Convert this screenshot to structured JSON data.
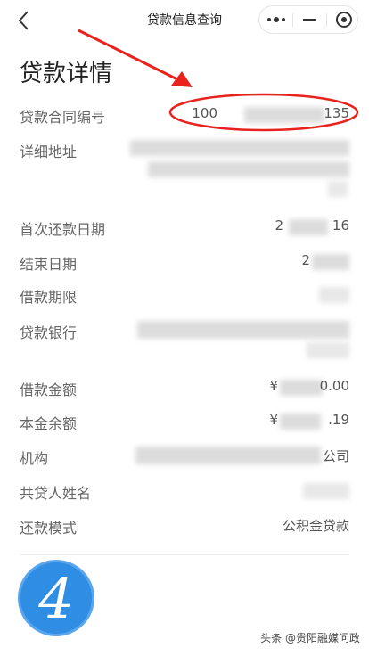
{
  "nav": {
    "title": "贷款信息查询",
    "back_icon": "chevron-left-icon",
    "more_icon": "more-dots-icon",
    "minimize_icon": "minus-icon",
    "close_icon": "target-circle-icon"
  },
  "page_title": "贷款详情",
  "fields": {
    "contract_no": {
      "label": "贷款合同编号",
      "value_prefix": "100",
      "value_suffix": "135"
    },
    "address": {
      "label": "详细地址"
    },
    "first_repay_date": {
      "label": "首次还款日期",
      "value_prefix": "2",
      "value_suffix": "16"
    },
    "end_date": {
      "label": "结束日期",
      "value_prefix": "2"
    },
    "loan_term": {
      "label": "借款期限"
    },
    "lending_bank": {
      "label": "贷款银行"
    },
    "loan_amount": {
      "label": "借款金额",
      "value_prefix": "¥",
      "value_suffix": "0.00"
    },
    "principal_balance": {
      "label": "本金余额",
      "value_prefix": "¥",
      "value_suffix": ".19"
    },
    "institution": {
      "label": "机构",
      "value_suffix": "公司"
    },
    "co_borrower": {
      "label": "共贷人姓名"
    },
    "repay_mode": {
      "label": "还款模式",
      "value": "公积金贷款"
    }
  },
  "badge_number": "4",
  "watermark": "头条 @贵阳融媒问政",
  "colors": {
    "annotation_red": "#e8231d",
    "badge_blue": "#2f8de4"
  }
}
